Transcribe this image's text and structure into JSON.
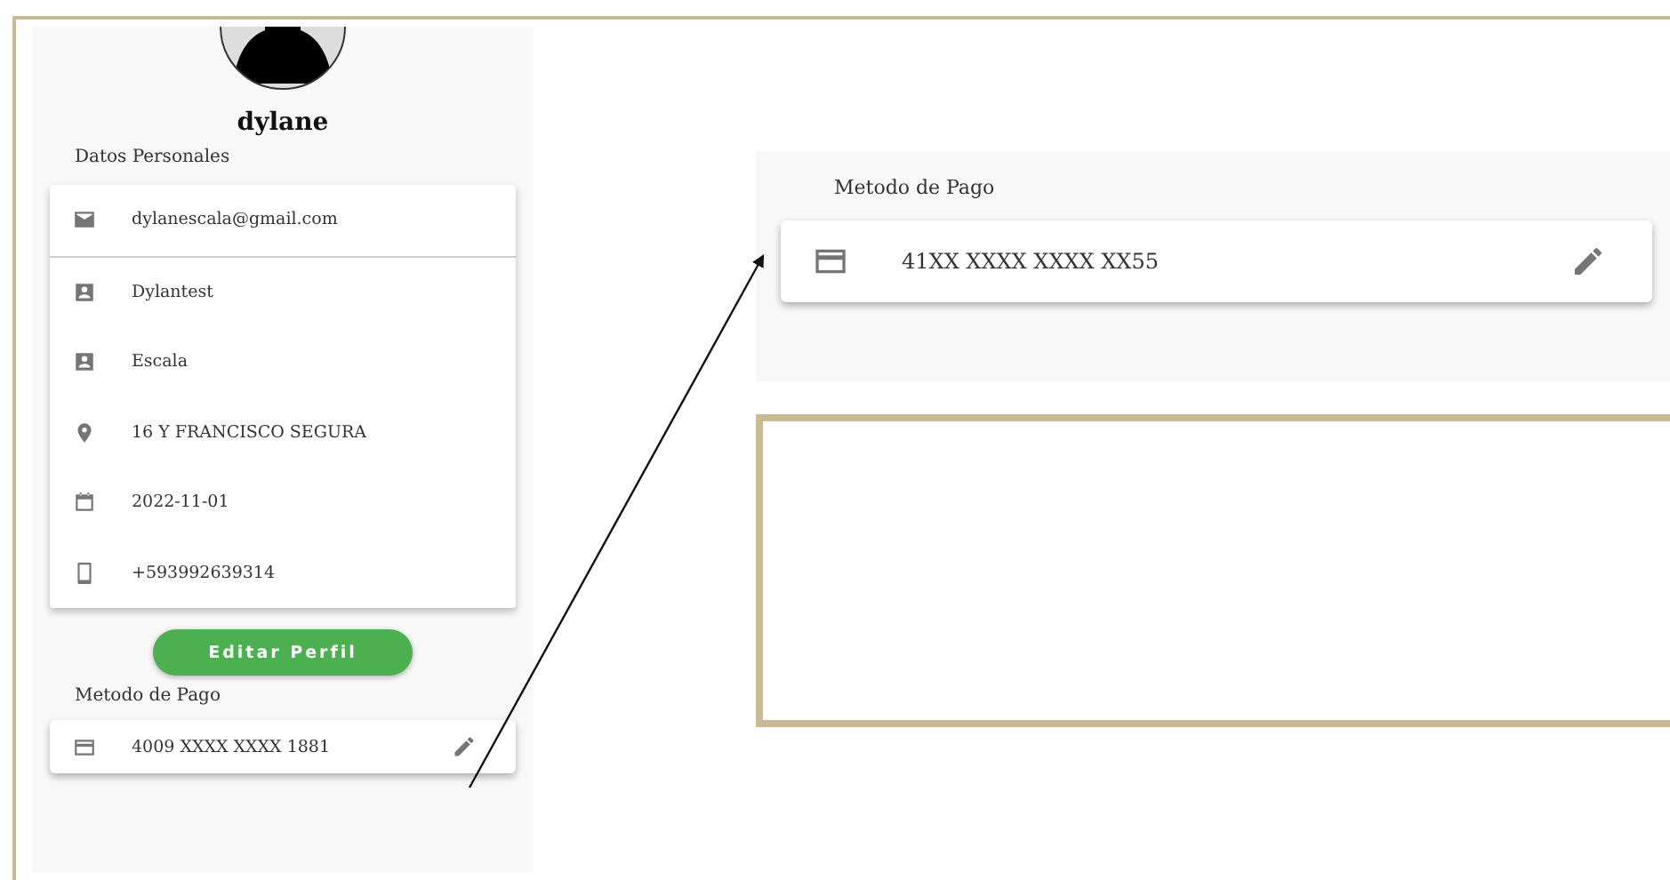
{
  "profile": {
    "name": "dylane",
    "section_title": "Datos Personales",
    "fields": [
      {
        "kind": "email",
        "value": "dylanescala@gmail.com"
      },
      {
        "kind": "person",
        "value": "Dylantest"
      },
      {
        "kind": "person",
        "value": "Escala"
      },
      {
        "kind": "location",
        "value": "16 Y FRANCISCO SEGURA"
      },
      {
        "kind": "calendar",
        "value": "2022-11-01"
      },
      {
        "kind": "phone",
        "value": "+593992639314"
      }
    ],
    "edit_button": "Editar Perfil",
    "payment": {
      "title": "Metodo de Pago",
      "card": "4009 XXXX XXXX 1881"
    }
  },
  "zoomed_payment": {
    "title": "Metodo de Pago",
    "card": "41XX XXXX XXXX XX55"
  }
}
